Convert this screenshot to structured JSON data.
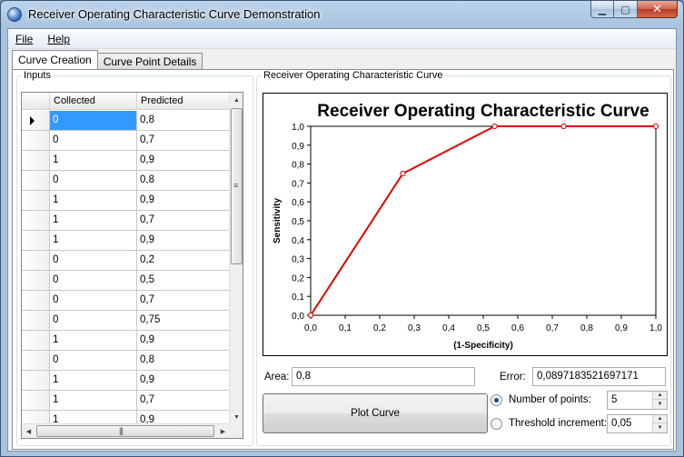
{
  "window": {
    "title": "Receiver Operating Characteristic Curve Demonstration",
    "minimize_glyph": "▁",
    "maximize_glyph": "▢",
    "close_glyph": "✕"
  },
  "menu": {
    "file": "File",
    "help": "Help"
  },
  "tabs": [
    {
      "label": "Curve Creation",
      "active": true
    },
    {
      "label": "Curve Point Details",
      "active": false
    }
  ],
  "inputs": {
    "legend": "Inputs",
    "columns": [
      "Collected",
      "Predicted"
    ],
    "rows": [
      {
        "collected": "0",
        "predicted": "0,8"
      },
      {
        "collected": "0",
        "predicted": "0,7"
      },
      {
        "collected": "1",
        "predicted": "0,9"
      },
      {
        "collected": "0",
        "predicted": "0,8"
      },
      {
        "collected": "1",
        "predicted": "0,9"
      },
      {
        "collected": "1",
        "predicted": "0,7"
      },
      {
        "collected": "1",
        "predicted": "0,9"
      },
      {
        "collected": "0",
        "predicted": "0,2"
      },
      {
        "collected": "0",
        "predicted": "0,5"
      },
      {
        "collected": "0",
        "predicted": "0,7"
      },
      {
        "collected": "0",
        "predicted": "0,75"
      },
      {
        "collected": "1",
        "predicted": "0,9"
      },
      {
        "collected": "0",
        "predicted": "0,8"
      },
      {
        "collected": "1",
        "predicted": "0,9"
      },
      {
        "collected": "1",
        "predicted": "0,7"
      },
      {
        "collected": "1",
        "predicted": "0,9"
      }
    ]
  },
  "chart_group": {
    "legend": "Receiver Operating Characteristic Curve"
  },
  "chart_data": {
    "type": "line",
    "title": "Receiver Operating Characteristic Curve",
    "xlabel": "(1-Specificity)",
    "ylabel": "Sensitivity",
    "xlim": [
      0,
      1
    ],
    "ylim": [
      0,
      1
    ],
    "x_ticks": [
      "0,0",
      "0,1",
      "0,2",
      "0,3",
      "0,4",
      "0,5",
      "0,6",
      "0,7",
      "0,8",
      "0,9",
      "1,0"
    ],
    "y_ticks": [
      "0,0",
      "0,1",
      "0,2",
      "0,3",
      "0,4",
      "0,5",
      "0,6",
      "0,7",
      "0,8",
      "0,9",
      "1,0"
    ],
    "grid": false,
    "series": [
      {
        "color": "#e00000",
        "points": [
          {
            "x": 0.0,
            "y": 0.0
          },
          {
            "x": 0.267,
            "y": 0.75
          },
          {
            "x": 0.533,
            "y": 1.0
          },
          {
            "x": 0.733,
            "y": 1.0
          },
          {
            "x": 1.0,
            "y": 1.0
          }
        ]
      }
    ]
  },
  "results": {
    "area_label": "Area:",
    "area_value": "0,8",
    "error_label": "Error:",
    "error_value": "0,0897183521697171"
  },
  "controls": {
    "plot_button": "Plot Curve",
    "num_points_label": "Number of points:",
    "num_points_value": "5",
    "num_points_selected": true,
    "threshold_label": "Threshold increment:",
    "threshold_value": "0,05",
    "threshold_selected": false
  }
}
